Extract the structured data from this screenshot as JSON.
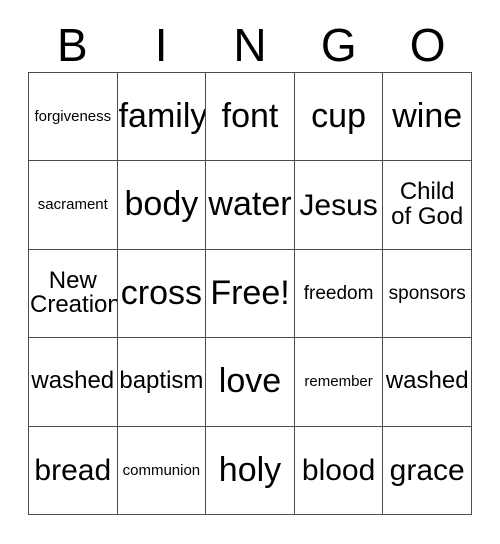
{
  "card": {
    "title": "BINGO Card",
    "header_letters": [
      "B",
      "I",
      "N",
      "G",
      "O"
    ],
    "grid_size": "5x5",
    "border_color": "#4d4d4d",
    "background_color": "#ffffff",
    "text_color": "#000000",
    "rows": [
      [
        {
          "label": "forgiveness",
          "size": "xs",
          "free": false
        },
        {
          "label": "family",
          "size": "xl",
          "free": false
        },
        {
          "label": "font",
          "size": "xl",
          "free": false
        },
        {
          "label": "cup",
          "size": "xl",
          "free": false
        },
        {
          "label": "wine",
          "size": "xl",
          "free": false
        }
      ],
      [
        {
          "label": "sacrament",
          "size": "xs",
          "free": false
        },
        {
          "label": "body",
          "size": "xl",
          "free": false
        },
        {
          "label": "water",
          "size": "xl",
          "free": false
        },
        {
          "label": "Jesus",
          "size": "l",
          "free": false
        },
        {
          "label": "Child\nof God",
          "size": "m",
          "free": false
        }
      ],
      [
        {
          "label": "New\nCreation",
          "size": "m",
          "free": false
        },
        {
          "label": "cross",
          "size": "xl",
          "free": false
        },
        {
          "label": "Free!",
          "size": "xl",
          "free": true
        },
        {
          "label": "freedom",
          "size": "s",
          "free": false
        },
        {
          "label": "sponsors",
          "size": "s",
          "free": false
        }
      ],
      [
        {
          "label": "washed",
          "size": "m",
          "free": false
        },
        {
          "label": "baptism",
          "size": "m",
          "free": false
        },
        {
          "label": "love",
          "size": "xl",
          "free": false
        },
        {
          "label": "remember",
          "size": "xs",
          "free": false
        },
        {
          "label": "washed",
          "size": "m",
          "free": false
        }
      ],
      [
        {
          "label": "bread",
          "size": "l",
          "free": false
        },
        {
          "label": "communion",
          "size": "xs",
          "free": false
        },
        {
          "label": "holy",
          "size": "xl",
          "free": false
        },
        {
          "label": "blood",
          "size": "l",
          "free": false
        },
        {
          "label": "grace",
          "size": "l",
          "free": false
        }
      ]
    ]
  }
}
